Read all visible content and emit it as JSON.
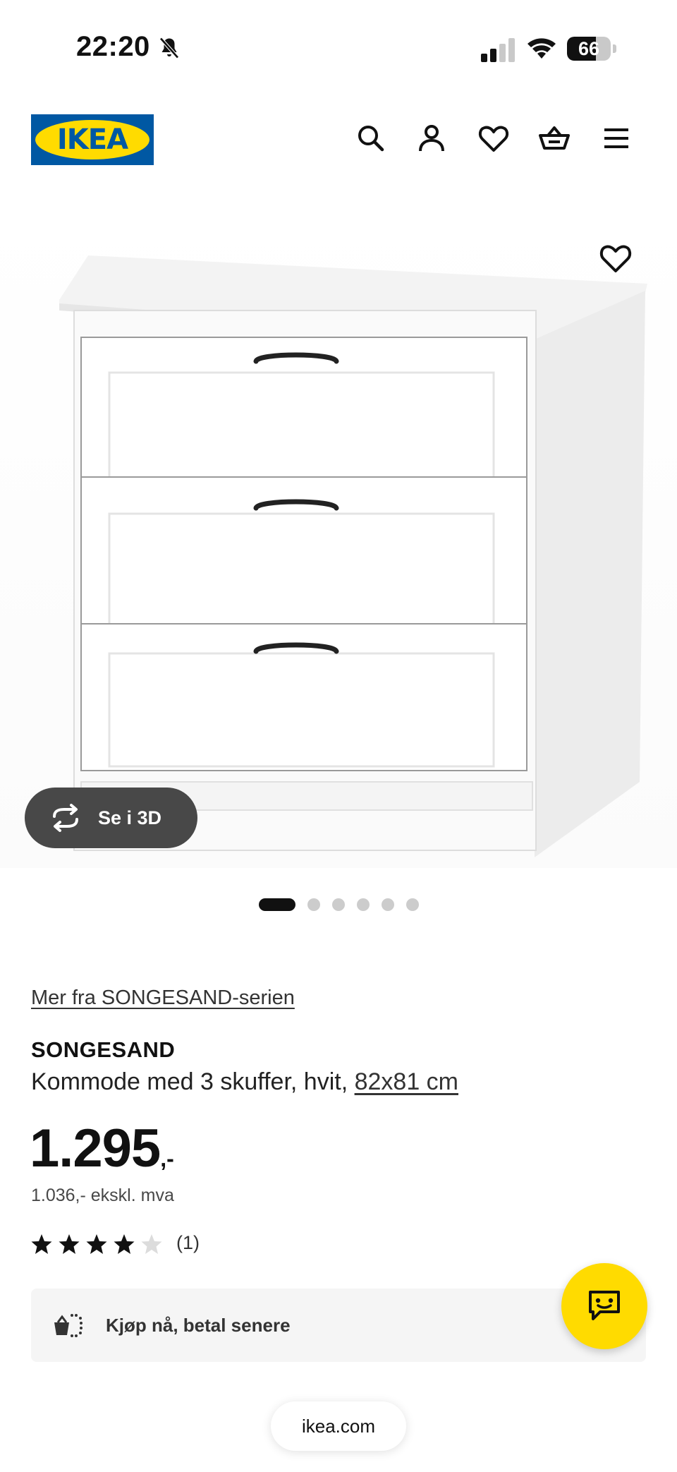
{
  "status_bar": {
    "time": "22:20",
    "battery": "66",
    "battery_level": 0.66,
    "icons": [
      "bell-slash-icon",
      "cellular-signal-icon",
      "wifi-icon",
      "battery-icon"
    ]
  },
  "header": {
    "logo_text": "IKEA",
    "icons": [
      "search-icon",
      "user-icon",
      "heart-icon",
      "shopping-basket-icon",
      "hamburger-menu-icon"
    ]
  },
  "gallery": {
    "view_3d_label": "Se i 3D",
    "slide_count": 6,
    "active_slide": 1
  },
  "product": {
    "series_link": "Mer fra SONGESAND-serien",
    "name": "SONGESAND",
    "description": "Kommode med 3 skuffer, hvit,",
    "size_link": "82x81 cm",
    "price_main": "1.295",
    "price_suffix": ",-",
    "price_ex_vat": "1.036,- ekskl. mva",
    "rating": 4,
    "rating_max": 5,
    "review_count": "(1)"
  },
  "bnpl": {
    "label": "Kjøp nå, betal senere"
  },
  "browser": {
    "url": "ikea.com"
  },
  "colors": {
    "ikea_blue": "#0058a3",
    "ikea_yellow": "#ffdb00",
    "pill_dark": "#484848",
    "panel_gray": "#f5f5f5"
  }
}
